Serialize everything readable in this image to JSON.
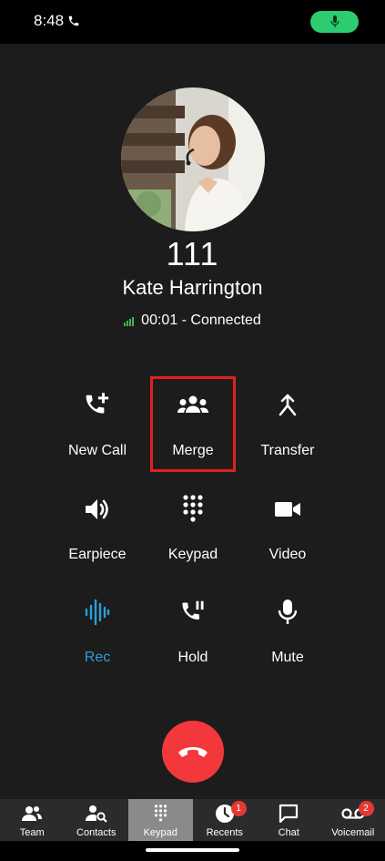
{
  "status_bar": {
    "time": "8:48"
  },
  "call": {
    "extension": "111",
    "caller_name": "Kate Harrington",
    "status": "00:01 - Connected"
  },
  "actions": [
    {
      "label": "New Call",
      "icon": "add-call-icon"
    },
    {
      "label": "Merge",
      "icon": "merge-group-icon"
    },
    {
      "label": "Transfer",
      "icon": "transfer-icon"
    },
    {
      "label": "Earpiece",
      "icon": "speaker-icon"
    },
    {
      "label": "Keypad",
      "icon": "keypad-icon"
    },
    {
      "label": "Video",
      "icon": "video-icon"
    },
    {
      "label": "Rec",
      "icon": "record-waveform-icon"
    },
    {
      "label": "Hold",
      "icon": "hold-icon"
    },
    {
      "label": "Mute",
      "icon": "mic-icon"
    }
  ],
  "tabs": [
    {
      "label": "Team",
      "icon": "team-icon"
    },
    {
      "label": "Contacts",
      "icon": "contacts-search-icon"
    },
    {
      "label": "Keypad",
      "icon": "keypad-icon",
      "active": true
    },
    {
      "label": "Recents",
      "icon": "clock-icon",
      "badge": "1"
    },
    {
      "label": "Chat",
      "icon": "chat-icon"
    },
    {
      "label": "Voicemail",
      "icon": "voicemail-icon",
      "badge": "2"
    }
  ],
  "colors": {
    "background": "#1c1c1c",
    "accent_green": "#2ecc71",
    "rec_blue": "#2a9fd6",
    "hangup_red": "#f2383a",
    "highlight_red": "#e02020"
  }
}
